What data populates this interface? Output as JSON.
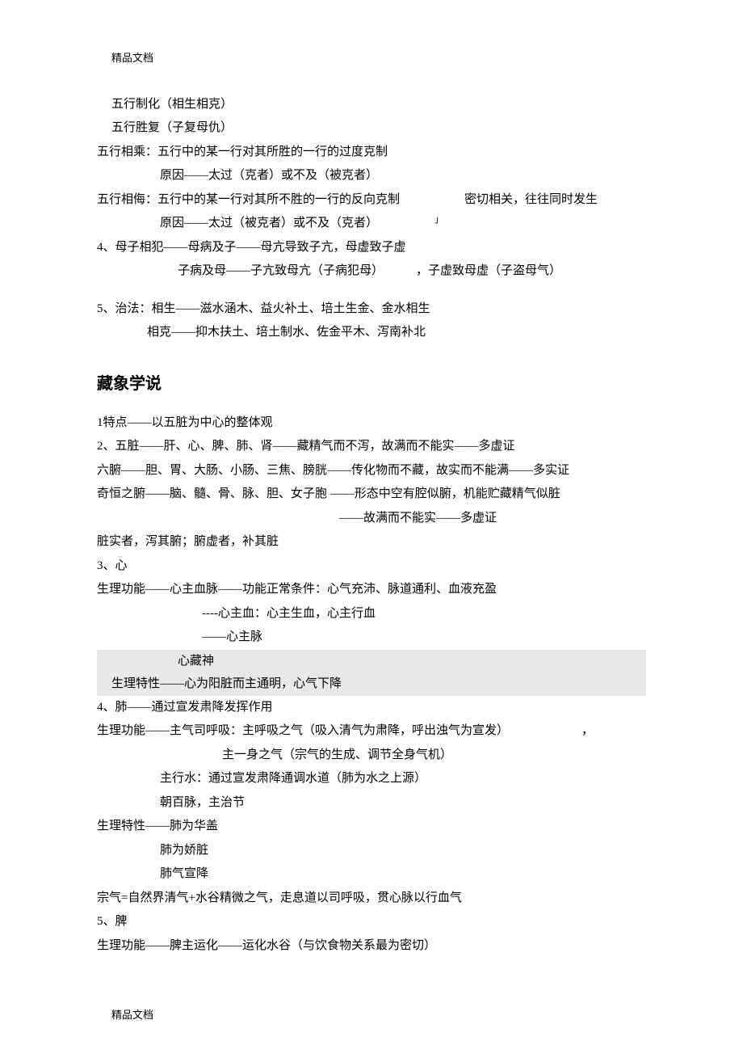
{
  "header": "精品文档",
  "wuxing": {
    "l1": "五行制化（相生相克）",
    "l2": "五行胜复（子复母仇）",
    "l3a": "五行相乘：五行中的某一行对其所胜的一行的过度克制",
    "l3b": "原因——太过（克者）或不及（被克者）",
    "l4a": "五行相侮：五行中的某一行对其所不胜的一行的反向克制",
    "l4b": "密切相关，往往同时发生",
    "l4c": "原因——太过（被克者）或不及（克者）",
    "l4d": "」",
    "l5a": "4、母子相犯——母病及子——母亢导致子亢，母虚致子虚",
    "l5b": "子病及母——子亢致母亢（子病犯母）",
    "l5c": "，子虚致母虚（子盗母气）",
    "l6a": "5、治法：相生——滋水涵木、益火补土、培土生金、金水相生",
    "l6b": "相克——抑木扶土、培土制水、佐金平木、泻南补北"
  },
  "zangxiang_title": "藏象学说",
  "zangxiang": {
    "l1": "1特点——以五脏为中心的整体观",
    "l2": "2、五脏——肝、心、脾、肺、肾——藏精气而不泻，故满而不能实——多虚证",
    "l3": "六腑——胆、胃、大肠、小肠、三焦、膀胱——传化物而不藏，故实而不能满——多实证",
    "l4": "奇恒之腑——脑、髓、骨、脉、胆、女子胞 ——形态中空有腔似腑，机能贮藏精气似脏",
    "l5": "——故满而不能实——多虚证",
    "l6": "脏实者，泻其腑；腑虚者，补其脏",
    "heart_title": "3、心",
    "heart1": "生理功能——心主血脉——功能正常条件：心气充沛、脉道通利、血液充盈",
    "heart2": "----心主血：心主生血，心主行血",
    "heart3": "——心主脉",
    "heart4": "心藏神",
    "heart5_pre": "生理特性——心为阳脏而主通明，心气下降",
    "lung_title": "4、肺——通过宣发肃降发挥作用",
    "lung1": "生理功能——主气司呼吸：主呼吸之气（吸入清气为肃降，呼出浊气为宣发）",
    "lung1_tail": "，",
    "lung2": "主一身之气（宗气的生成、调节全身气机）",
    "lung3": "主行水：通过宣发肃降通调水道（肺为水之上源）",
    "lung4": "朝百脉，主治节",
    "lung5": "生理特性——肺为华盖",
    "lung6": "肺为娇脏",
    "lung7": "肺气宣降",
    "lung8": "宗气=自然界清气+水谷精微之气，走息道以司呼吸，贯心脉以行血气",
    "spleen_title": "5、脾",
    "spleen1": "生理功能——脾主运化——运化水谷（与饮食物关系最为密切）"
  },
  "footer": "精品文档"
}
